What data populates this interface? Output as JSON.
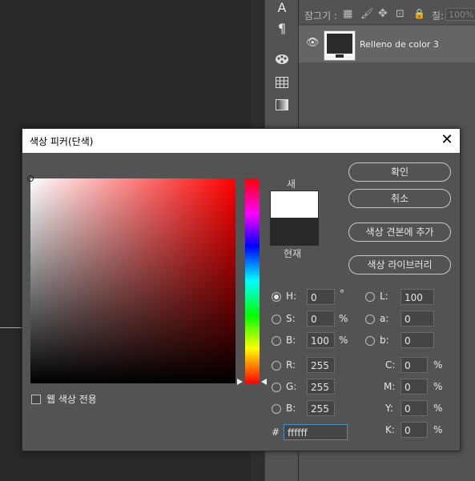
{
  "background": {
    "tools": [
      "A",
      "¶"
    ],
    "lock_label": "잠그기 :",
    "fill_label": "칠:",
    "fill_value": "100%",
    "layer_name": "Relleno de color 3"
  },
  "dialog": {
    "title": "색상 피커(단색)",
    "new_label": "새",
    "current_label": "현재",
    "buttons": {
      "ok": "확인",
      "cancel": "취소",
      "add_swatch": "색상 견본에 추가",
      "libraries": "색상 라이브러리"
    },
    "web_only_label": "웹 색상 전용",
    "fields": {
      "H": {
        "label": "H:",
        "value": "0",
        "unit": "°"
      },
      "S": {
        "label": "S:",
        "value": "0",
        "unit": "%"
      },
      "Bv": {
        "label": "B:",
        "value": "100",
        "unit": "%"
      },
      "R": {
        "label": "R:",
        "value": "255"
      },
      "G": {
        "label": "G:",
        "value": "255"
      },
      "Bc": {
        "label": "B:",
        "value": "255"
      },
      "L": {
        "label": "L:",
        "value": "100"
      },
      "a": {
        "label": "a:",
        "value": "0"
      },
      "b": {
        "label": "b:",
        "value": "0"
      },
      "C": {
        "label": "C:",
        "value": "0",
        "unit": "%"
      },
      "M": {
        "label": "M:",
        "value": "0",
        "unit": "%"
      },
      "Y": {
        "label": "Y:",
        "value": "0",
        "unit": "%"
      },
      "K": {
        "label": "K:",
        "value": "0",
        "unit": "%"
      }
    },
    "hex_label": "#",
    "hex_value": "ffffff",
    "colors": {
      "new": "#ffffff",
      "current": "#282828"
    }
  }
}
